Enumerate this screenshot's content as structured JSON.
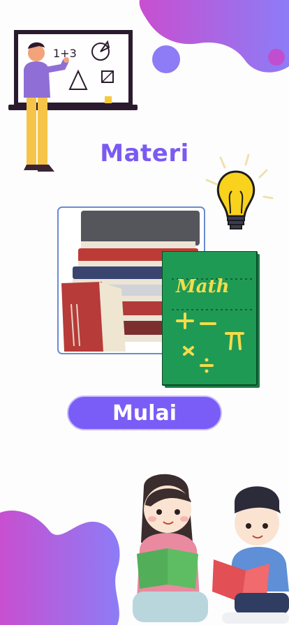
{
  "screen": {
    "title": "Materi",
    "start_button_label": "Mulai"
  },
  "illustrations": {
    "teacher_board": [
      "1+3"
    ],
    "math_book_title": "Math",
    "math_book_symbols": [
      "+",
      "−",
      "π",
      "×",
      "÷"
    ]
  },
  "colors": {
    "accent": "#7a5cf6",
    "title": "#7a5af2",
    "blob_gradient_start": "#c84fd0",
    "blob_gradient_end": "#8d7cf6",
    "book_green": "#1f9a55",
    "book_text": "#f4dc4b"
  },
  "icons": [
    "lightbulb-icon"
  ]
}
